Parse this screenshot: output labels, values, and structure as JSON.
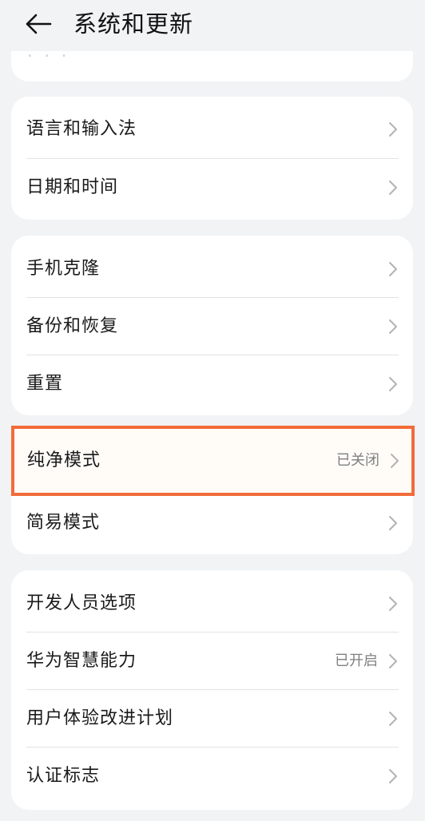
{
  "header": {
    "title": "系统和更新"
  },
  "groups": [
    {
      "items": [
        {
          "label": "语言和输入法",
          "value": ""
        },
        {
          "label": "日期和时间",
          "value": ""
        }
      ]
    },
    {
      "items": [
        {
          "label": "手机克隆",
          "value": ""
        },
        {
          "label": "备份和恢复",
          "value": ""
        },
        {
          "label": "重置",
          "value": ""
        }
      ]
    },
    {
      "items": [
        {
          "label": "纯净模式",
          "value": "已关闭"
        },
        {
          "label": "简易模式",
          "value": ""
        }
      ]
    },
    {
      "items": [
        {
          "label": "开发人员选项",
          "value": ""
        },
        {
          "label": "华为智慧能力",
          "value": "已开启"
        },
        {
          "label": "用户体验改进计划",
          "value": ""
        },
        {
          "label": "认证标志",
          "value": ""
        }
      ]
    }
  ],
  "colors": {
    "background": "#f1f3f5",
    "card": "#ffffff",
    "highlight_border": "#f26b3a",
    "secondary_text": "#808080"
  },
  "icons": {
    "back": "arrow-left-icon",
    "chevron": "chevron-right-icon"
  }
}
